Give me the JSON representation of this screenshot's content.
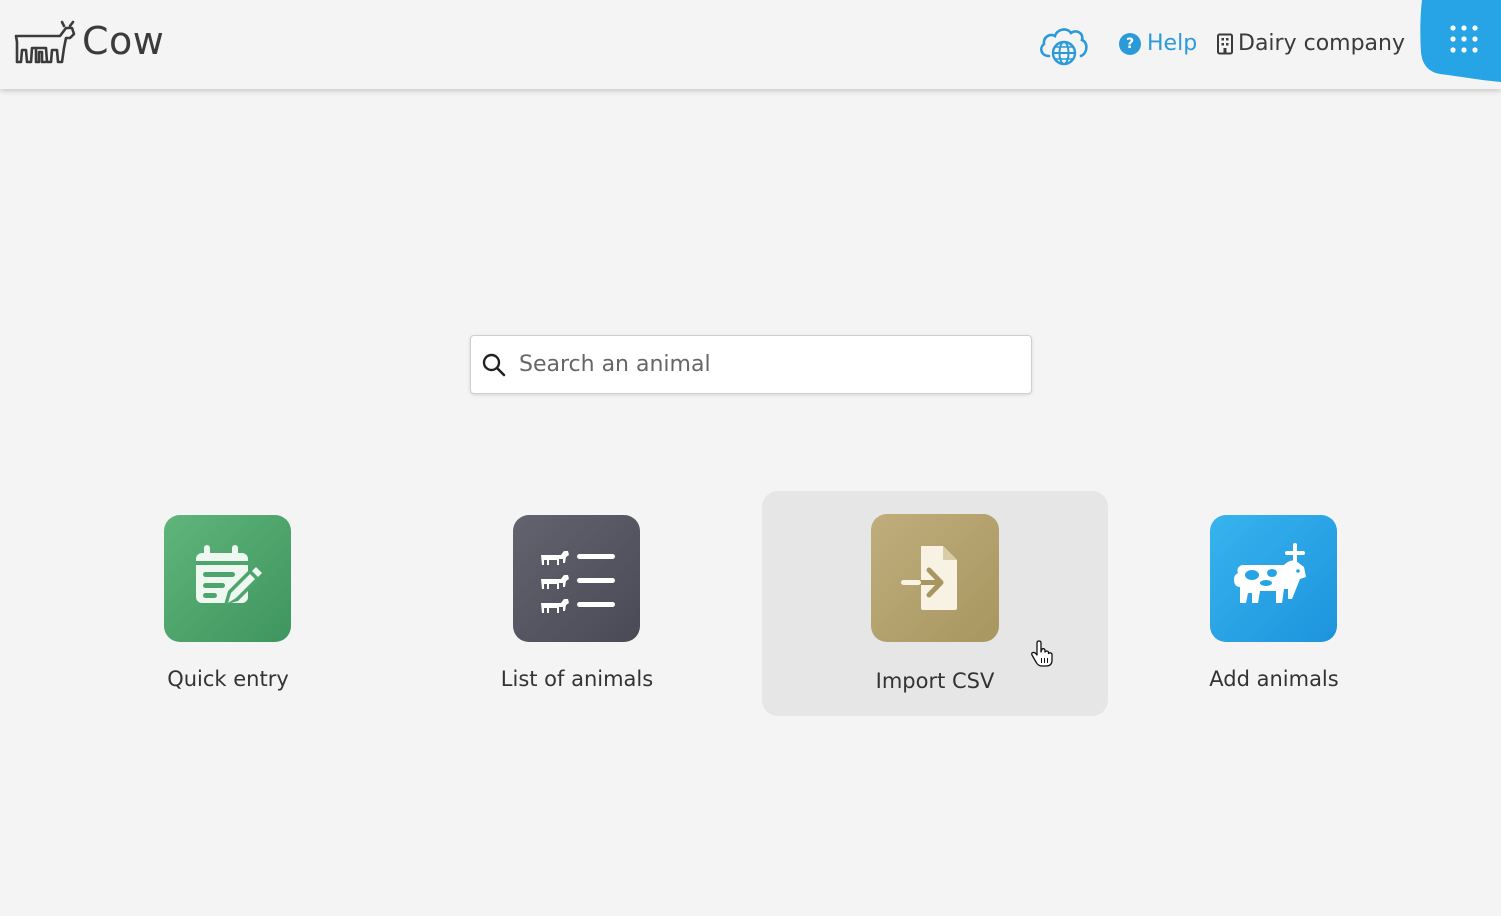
{
  "header": {
    "app_name": "Cow",
    "logo_icon": "cow-calf-logo-icon",
    "sync_icon": "cloud-globe-icon",
    "help_label": "Help",
    "help_icon": "question-circle-icon",
    "company_label": "Dairy company",
    "company_icon": "building-icon",
    "apps_icon": "grid-dots-icon",
    "accent_color": "#2a9bd8"
  },
  "search": {
    "placeholder": "Search an animal",
    "value": "",
    "icon": "search-icon"
  },
  "tiles": [
    {
      "label": "Quick entry",
      "icon": "calendar-edit-icon",
      "color": "#4ea56c"
    },
    {
      "label": "List of animals",
      "icon": "cow-list-icon",
      "color": "#55555f"
    },
    {
      "label": "Import CSV",
      "icon": "file-import-icon",
      "color": "#b3a26e",
      "hovered": true
    },
    {
      "label": "Add animals",
      "icon": "add-cow-icon",
      "color": "#27a4e6"
    }
  ]
}
